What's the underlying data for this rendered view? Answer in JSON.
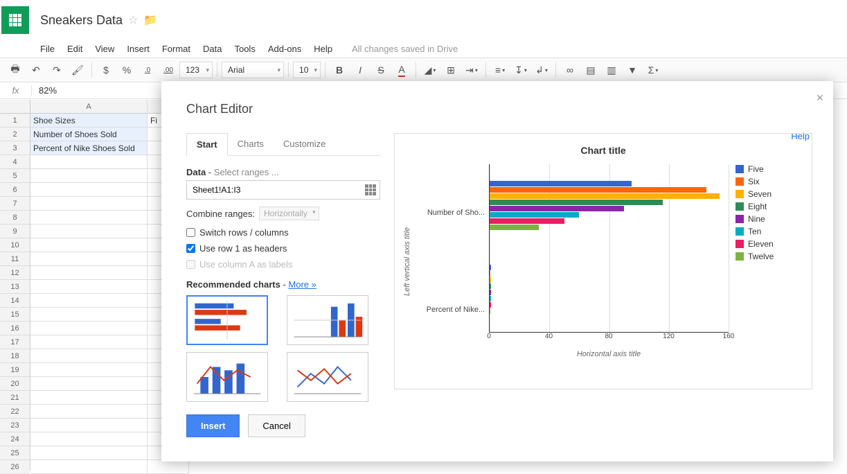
{
  "doc": {
    "title": "Sneakers Data"
  },
  "menu": {
    "file": "File",
    "edit": "Edit",
    "view": "View",
    "insert": "Insert",
    "format": "Format",
    "data": "Data",
    "tools": "Tools",
    "addons": "Add-ons",
    "help": "Help",
    "status": "All changes saved in Drive"
  },
  "toolbar": {
    "dollar": "$",
    "percent": "%",
    "dec1": ".0",
    "dec2": ".00",
    "num": "123",
    "font": "Arial",
    "size": "10"
  },
  "fx": {
    "label": "fx",
    "value": "82%"
  },
  "sheet": {
    "colA_header": "A",
    "rows": [
      "Shoe Sizes",
      "Number of Shoes Sold",
      "Percent of Nike Shoes Sold"
    ],
    "colB_vis": "Fi"
  },
  "modal": {
    "title": "Chart Editor",
    "help": "Help",
    "tabs": {
      "start": "Start",
      "charts": "Charts",
      "customize": "Customize"
    },
    "data_label": "Data",
    "data_sub": "Select ranges ...",
    "range": "Sheet1!A1:I3",
    "combine_label": "Combine ranges:",
    "combine_val": "Horizontally",
    "switch": "Switch rows / columns",
    "row1": "Use row 1 as headers",
    "colA": "Use column A as labels",
    "rec": "Recommended charts",
    "more": "More »",
    "insert": "Insert",
    "cancel": "Cancel"
  },
  "chart_data": {
    "type": "bar",
    "title": "Chart title",
    "xlabel": "Horizontal axis title",
    "ylabel": "Left vertical axis title",
    "xlim": [
      0,
      160
    ],
    "xticks": [
      0,
      40,
      80,
      120,
      160
    ],
    "categories": [
      "Number of Sho...",
      "Percent of Nike..."
    ],
    "series": [
      {
        "name": "Five",
        "color": "#3366cc",
        "values": [
          95,
          0.72
        ]
      },
      {
        "name": "Six",
        "color": "#ff6600",
        "values": [
          145,
          0.66
        ]
      },
      {
        "name": "Seven",
        "color": "#ffb000",
        "values": [
          154,
          0.8
        ]
      },
      {
        "name": "Eight",
        "color": "#2e8b57",
        "values": [
          116,
          0.75
        ]
      },
      {
        "name": "Nine",
        "color": "#8e24aa",
        "values": [
          90,
          0.82
        ]
      },
      {
        "name": "Ten",
        "color": "#00acc1",
        "values": [
          60,
          0.9
        ]
      },
      {
        "name": "Eleven",
        "color": "#e91e63",
        "values": [
          50,
          0.85
        ]
      },
      {
        "name": "Twelve",
        "color": "#7cb342",
        "values": [
          33,
          0.62
        ]
      }
    ]
  }
}
